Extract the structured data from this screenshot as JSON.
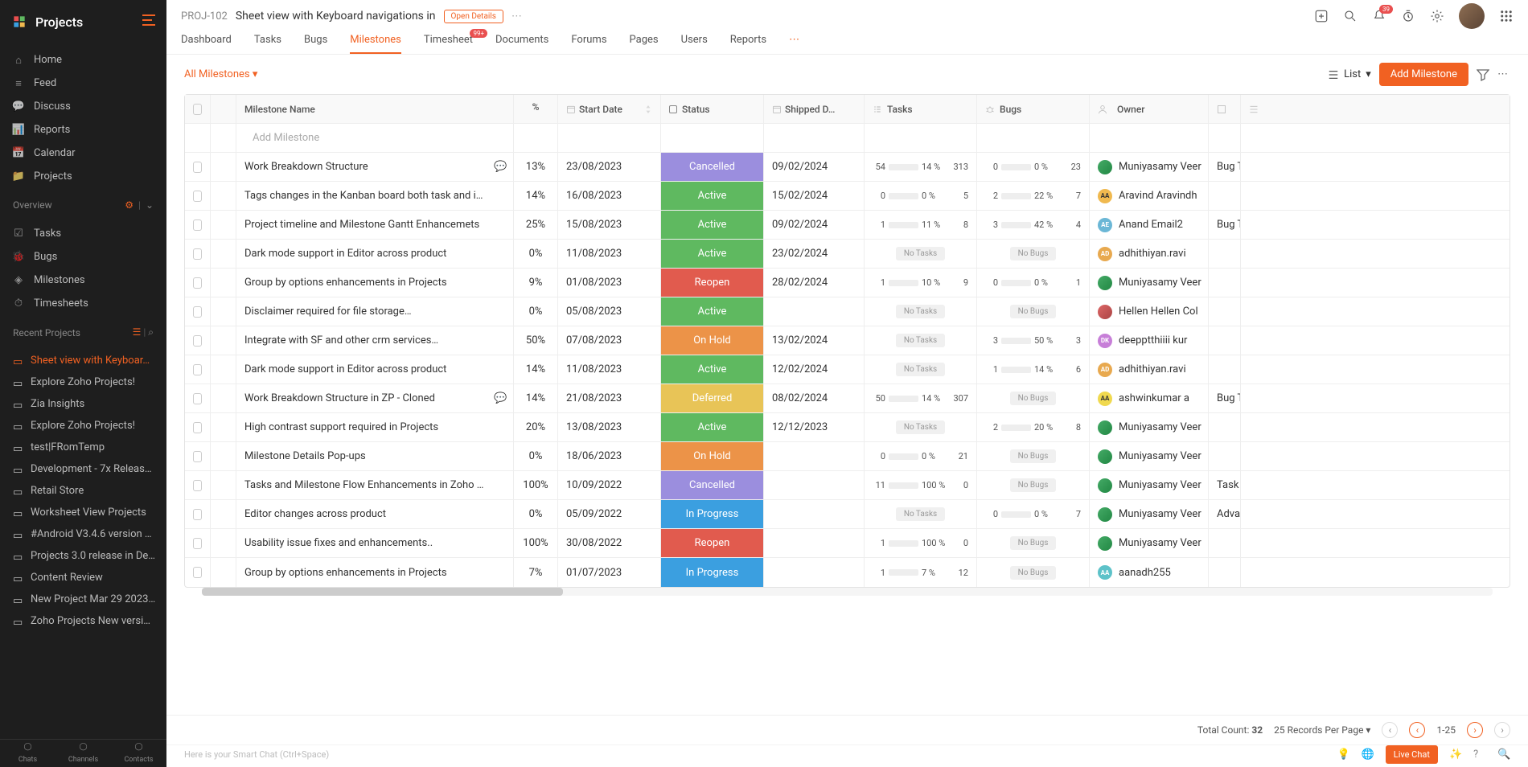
{
  "sidebar": {
    "title": "Projects",
    "nav": [
      {
        "label": "Home",
        "icon": "home"
      },
      {
        "label": "Feed",
        "icon": "feed"
      },
      {
        "label": "Discuss",
        "icon": "discuss"
      },
      {
        "label": "Reports",
        "icon": "reports"
      },
      {
        "label": "Calendar",
        "icon": "calendar"
      },
      {
        "label": "Projects",
        "icon": "projects"
      }
    ],
    "overview_label": "Overview",
    "overview_items": [
      {
        "label": "Tasks",
        "icon": "tasks"
      },
      {
        "label": "Bugs",
        "icon": "bugs"
      },
      {
        "label": "Milestones",
        "icon": "milestones"
      },
      {
        "label": "Timesheets",
        "icon": "timesheets"
      }
    ],
    "recent_label": "Recent Projects",
    "recent_items": [
      {
        "label": "Sheet view with Keyboar…",
        "active": true
      },
      {
        "label": "Explore Zoho Projects!"
      },
      {
        "label": "Zia Insights"
      },
      {
        "label": "Explore Zoho Projects!"
      },
      {
        "label": "test|FRomTemp"
      },
      {
        "label": "Development - 7x Releas…"
      },
      {
        "label": "Retail Store"
      },
      {
        "label": "Worksheet View Projects"
      },
      {
        "label": "#Android V3.4.6 version …"
      },
      {
        "label": "Projects 3.0 release in De…"
      },
      {
        "label": "Content Review"
      },
      {
        "label": "New Project Mar 29 2023…"
      },
      {
        "label": "Zoho Projects New versi…"
      }
    ],
    "bottom_tabs": [
      "Chats",
      "Channels",
      "Contacts"
    ]
  },
  "header": {
    "project_id": "PROJ-102",
    "project_title": "Sheet view with Keyboard navigations in",
    "open_details": "Open Details",
    "notification_count": "39"
  },
  "tabs": [
    {
      "label": "Dashboard"
    },
    {
      "label": "Tasks"
    },
    {
      "label": "Bugs"
    },
    {
      "label": "Milestones",
      "active": true
    },
    {
      "label": "Timesheet",
      "badge": "99+"
    },
    {
      "label": "Documents"
    },
    {
      "label": "Forums"
    },
    {
      "label": "Pages"
    },
    {
      "label": "Users"
    },
    {
      "label": "Reports"
    }
  ],
  "toolbar": {
    "filter": "All Milestones",
    "view": "List",
    "add_button": "Add Milestone"
  },
  "columns": {
    "name": "Milestone Name",
    "pct": "%",
    "start_date": "Start Date",
    "status": "Status",
    "shipped": "Shipped D…",
    "tasks": "Tasks",
    "bugs": "Bugs",
    "owner": "Owner"
  },
  "add_row_placeholder": "Add Milestone",
  "rows": [
    {
      "name": "Work Breakdown Structure",
      "chat": true,
      "pct": "13%",
      "date": "23/08/2023",
      "status": "Cancelled",
      "status_cls": "st-cancelled",
      "shipped": "09/02/2024",
      "tasks": {
        "l": "54",
        "p": 14,
        "pl": "14 %",
        "r": "313"
      },
      "bugs": {
        "l": "0",
        "p": 0,
        "pl": "0 %",
        "r": "23"
      },
      "owner": "Muniyasamy Veer",
      "av": "av-1",
      "extra": "Bug T"
    },
    {
      "name": "Tags changes in the Kanban board both task and i…",
      "pct": "14%",
      "date": "16/08/2023",
      "status": "Active",
      "status_cls": "st-active",
      "shipped": "15/02/2024",
      "tasks": {
        "l": "0",
        "p": 0,
        "pl": "0 %",
        "r": "5"
      },
      "bugs": {
        "l": "2",
        "p": 22,
        "pl": "22 %",
        "r": "7"
      },
      "owner": "Aravind Aravindh",
      "av": "av-2",
      "av_txt": "AA"
    },
    {
      "name": "Project timeline and Milestone Gantt Enhancemets",
      "pct": "25%",
      "date": "15/08/2023",
      "status": "Active",
      "status_cls": "st-active",
      "shipped": "09/02/2024",
      "tasks": {
        "l": "1",
        "p": 11,
        "pl": "11 %",
        "r": "8"
      },
      "bugs": {
        "l": "3",
        "p": 42,
        "pl": "42 %",
        "r": "4"
      },
      "owner": "Anand Email2",
      "av": "av-3",
      "av_txt": "AE",
      "extra": "Bug T"
    },
    {
      "name": "Dark mode support in Editor across product",
      "pct": "0%",
      "date": "11/08/2023",
      "status": "Active",
      "status_cls": "st-active",
      "shipped": "23/02/2024",
      "tasks": {
        "none": "No Tasks"
      },
      "bugs": {
        "none": "No Bugs"
      },
      "owner": "adhithiyan.ravi",
      "av": "av-4",
      "av_txt": "AD"
    },
    {
      "name": "Group by options enhancements in Projects",
      "pct": "9%",
      "date": "01/08/2023",
      "status": "Reopen",
      "status_cls": "st-reopen",
      "shipped": "28/02/2024",
      "tasks": {
        "l": "1",
        "p": 10,
        "pl": "10 %",
        "r": "9"
      },
      "bugs": {
        "l": "0",
        "p": 0,
        "pl": "0 %",
        "r": "1"
      },
      "owner": "Muniyasamy Veer",
      "av": "av-1"
    },
    {
      "name": "Disclaimer required for file storage…",
      "pct": "0%",
      "date": "05/08/2023",
      "status": "Active",
      "status_cls": "st-active",
      "shipped": "",
      "tasks": {
        "none": "No Tasks"
      },
      "bugs": {
        "none": "No Bugs"
      },
      "owner": "Hellen Hellen Col",
      "av": "av-5"
    },
    {
      "name": "Integrate with SF and other crm services…",
      "pct": "50%",
      "date": "07/08/2023",
      "status": "On Hold",
      "status_cls": "st-onhold",
      "shipped": "13/02/2024",
      "tasks": {
        "none": "No Tasks"
      },
      "bugs": {
        "l": "3",
        "p": 50,
        "pl": "50 %",
        "r": "3"
      },
      "owner": "deepptthiiii kur",
      "av": "av-6",
      "av_txt": "DK"
    },
    {
      "name": "Dark mode support in Editor across product",
      "pct": "14%",
      "date": "11/08/2023",
      "status": "Active",
      "status_cls": "st-active",
      "shipped": "12/02/2024",
      "tasks": {
        "none": "No Tasks"
      },
      "bugs": {
        "l": "1",
        "p": 14,
        "pl": "14 %",
        "r": "6"
      },
      "owner": "adhithiyan.ravi",
      "av": "av-4",
      "av_txt": "AD"
    },
    {
      "name": "Work Breakdown Structure in ZP - Cloned",
      "chat": true,
      "pct": "14%",
      "date": "21/08/2023",
      "status": "Deferred",
      "status_cls": "st-deferred",
      "shipped": "08/02/2024",
      "tasks": {
        "l": "50",
        "p": 14,
        "pl": "14 %",
        "r": "307"
      },
      "bugs": {
        "none": "No Bugs"
      },
      "owner": "ashwinkumar a",
      "av": "av-7",
      "av_txt": "AA",
      "extra": "Bug T"
    },
    {
      "name": "High contrast support required in Projects",
      "pct": "20%",
      "date": "13/08/2023",
      "status": "Active",
      "status_cls": "st-active",
      "shipped": "12/12/2023",
      "tasks": {
        "none": "No Tasks"
      },
      "bugs": {
        "l": "2",
        "p": 20,
        "pl": "20 %",
        "r": "8"
      },
      "owner": "Muniyasamy Veer",
      "av": "av-1"
    },
    {
      "name": "Milestone Details Pop-ups",
      "pct": "0%",
      "date": "18/06/2023",
      "status": "On Hold",
      "status_cls": "st-onhold",
      "shipped": "",
      "tasks": {
        "l": "0",
        "p": 0,
        "pl": "0 %",
        "r": "21"
      },
      "bugs": {
        "none": "No Bugs"
      },
      "owner": "Muniyasamy Veer",
      "av": "av-1"
    },
    {
      "name": "Tasks and Milestone Flow Enhancements in Zoho …",
      "pct": "100%",
      "date": "10/09/2022",
      "status": "Cancelled",
      "status_cls": "st-cancelled",
      "shipped": "",
      "tasks": {
        "l": "11",
        "p": 100,
        "pl": "100 %",
        "r": "0"
      },
      "bugs": {
        "none": "No Bugs"
      },
      "owner": "Muniyasamy Veer",
      "av": "av-1",
      "extra": "Task a"
    },
    {
      "name": "Editor changes across product",
      "pct": "0%",
      "date": "05/09/2022",
      "status": "In Progress",
      "status_cls": "st-inprogress",
      "shipped": "",
      "tasks": {
        "none": "No Tasks"
      },
      "bugs": {
        "l": "0",
        "p": 0,
        "pl": "0 %",
        "r": "7"
      },
      "owner": "Muniyasamy Veer",
      "av": "av-1",
      "extra": "Advar"
    },
    {
      "name": "Usability issue fixes and enhancements..",
      "pct": "100%",
      "date": "30/08/2022",
      "status": "Reopen",
      "status_cls": "st-reopen",
      "shipped": "",
      "tasks": {
        "l": "1",
        "p": 100,
        "pl": "100 %",
        "r": "0"
      },
      "bugs": {
        "none": "No Bugs"
      },
      "owner": "Muniyasamy Veer",
      "av": "av-1"
    },
    {
      "name": "Group by options enhancements in Projects",
      "pct": "7%",
      "date": "01/07/2023",
      "status": "In Progress",
      "status_cls": "st-inprogress",
      "shipped": "",
      "tasks": {
        "l": "1",
        "p": 7,
        "pl": "7 %",
        "r": "12"
      },
      "bugs": {
        "none": "No Bugs"
      },
      "owner": "aanadh255",
      "av": "av-8",
      "av_txt": "AA"
    }
  ],
  "footer": {
    "smart_chat": "Here is your Smart Chat (Ctrl+Space)",
    "total_count_label": "Total Count:",
    "total_count": "32",
    "per_page": "25 Records Per Page",
    "range": "1-25",
    "live_chat": "Live Chat"
  }
}
